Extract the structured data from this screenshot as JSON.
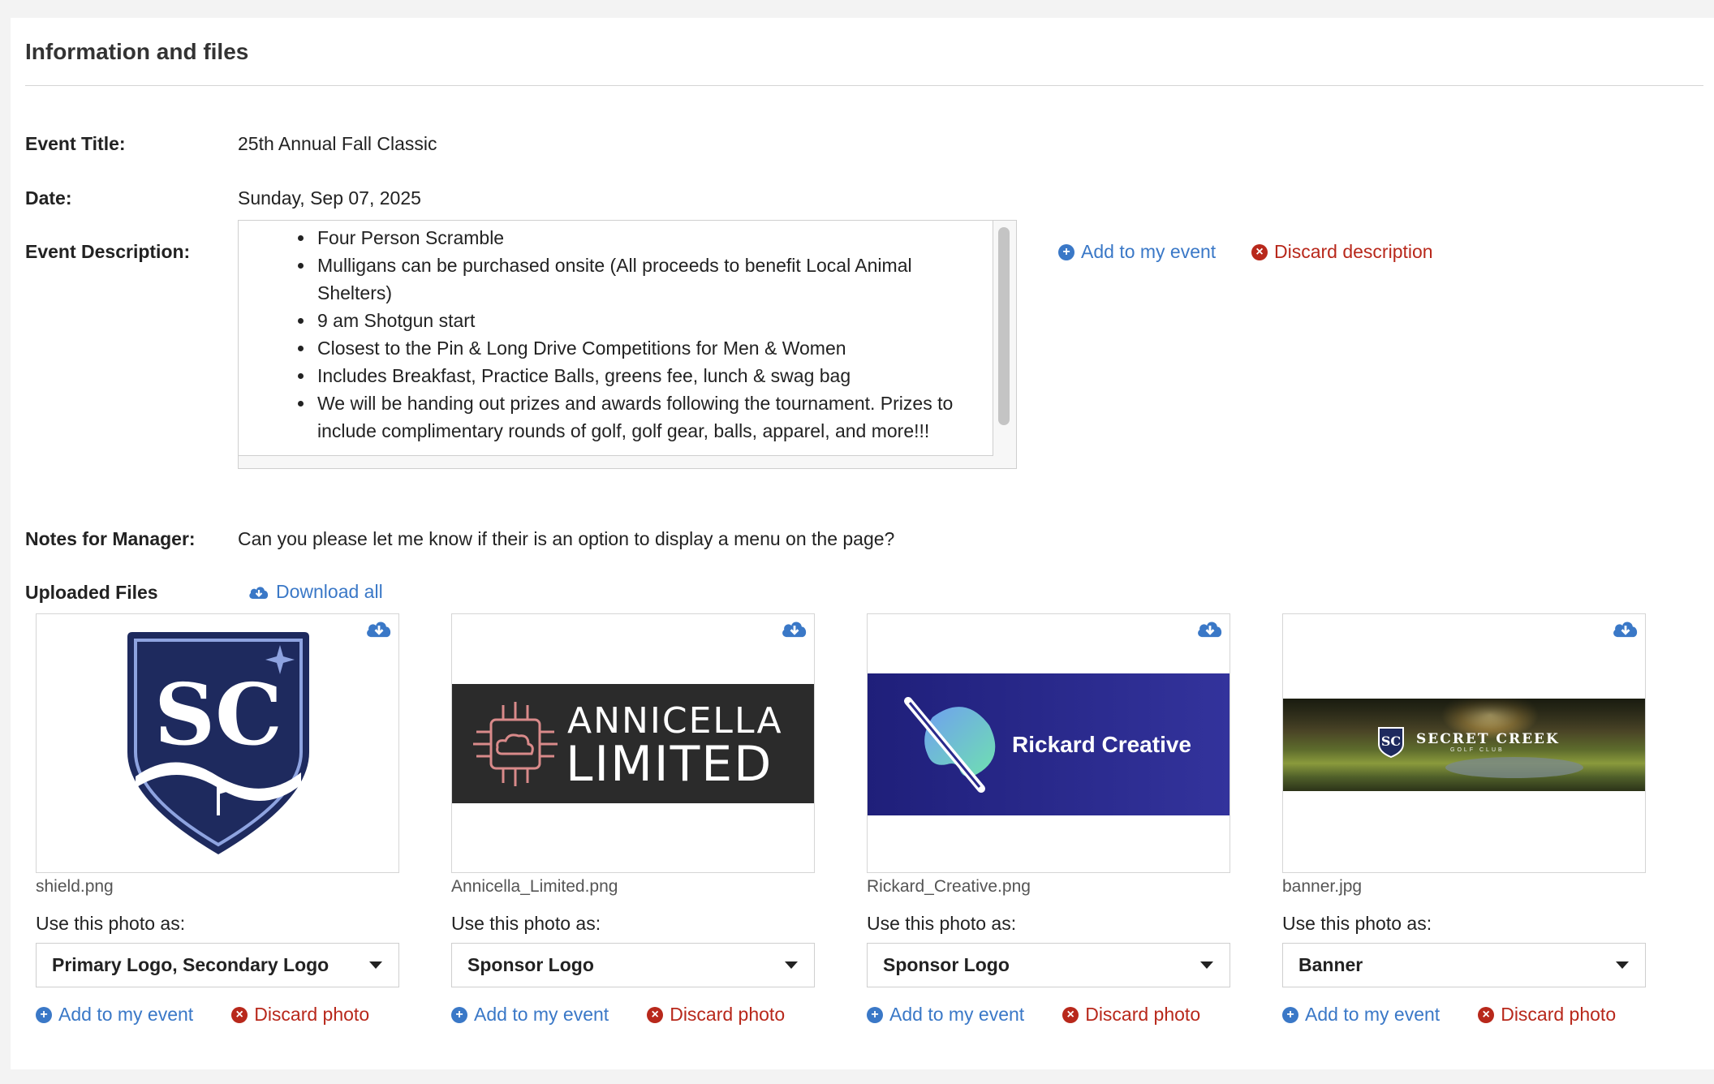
{
  "section": {
    "title": "Information and files"
  },
  "fields": {
    "event_title_label": "Event Title:",
    "event_title_value": "25th Annual Fall Classic",
    "date_label": "Date:",
    "date_value": "Sunday, Sep 07, 2025",
    "description_label": "Event Description:",
    "description_items": [
      "Four Person Scramble",
      "Mulligans can be purchased onsite (All proceeds to benefit Local Animal Shelters)",
      "9 am Shotgun start",
      "Closest to the Pin & Long Drive Competitions for Men & Women",
      "Includes Breakfast, Practice Balls, greens fee, lunch & swag bag",
      "We will be handing out prizes and awards following the tournament. Prizes to include complimentary rounds of golf, golf gear, balls, apparel, and more!!!"
    ],
    "description_add": "Add to my event",
    "description_discard": "Discard description",
    "notes_label": "Notes for Manager:",
    "notes_value": "Can you please let me know if their is an option to display a menu on the page?",
    "uploaded_label": "Uploaded Files",
    "download_all": "Download all"
  },
  "files": [
    {
      "name": "shield.png",
      "use_label": "Use this photo as:",
      "use_value": "Primary Logo, Secondary Logo",
      "add": "Add to my event",
      "discard": "Discard photo"
    },
    {
      "name": "Annicella_Limited.png",
      "use_label": "Use this photo as:",
      "use_value": "Sponsor Logo",
      "add": "Add to my event",
      "discard": "Discard photo",
      "logo_top": "ANNICELLA",
      "logo_bottom": "LIMITED"
    },
    {
      "name": "Rickard_Creative.png",
      "use_label": "Use this photo as:",
      "use_value": "Sponsor Logo",
      "add": "Add to my event",
      "discard": "Discard photo",
      "logo_text": "Rickard Creative"
    },
    {
      "name": "banner.jpg",
      "use_label": "Use this photo as:",
      "use_value": "Banner",
      "add": "Add to my event",
      "discard": "Discard photo",
      "logo_text": "SECRET CREEK",
      "logo_sub": "GOLF CLUB"
    }
  ],
  "colors": {
    "link_blue": "#3a78c7",
    "link_red": "#b8281b",
    "shield_navy": "#1e2a5e",
    "rickard_bg": "#2a2a8c",
    "annicella_bg": "#2b2b2b"
  }
}
